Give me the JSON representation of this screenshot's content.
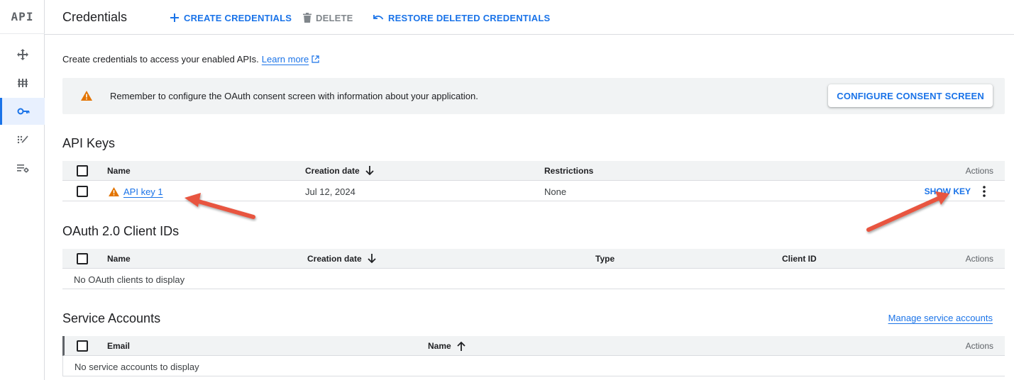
{
  "rail": {
    "logo": "API",
    "items": [
      {
        "icon": "dashboard-icon"
      },
      {
        "icon": "library-icon"
      },
      {
        "icon": "key-icon",
        "active": true
      },
      {
        "icon": "consent-icon"
      },
      {
        "icon": "settings-list-icon"
      }
    ]
  },
  "topbar": {
    "title": "Credentials",
    "create_label": "CREATE CREDENTIALS",
    "delete_label": "DELETE",
    "restore_label": "RESTORE DELETED CREDENTIALS"
  },
  "intro": {
    "text": "Create credentials to access your enabled APIs.",
    "link": "Learn more"
  },
  "banner": {
    "text": "Remember to configure the OAuth consent screen with information about your application.",
    "button": "CONFIGURE CONSENT SCREEN"
  },
  "api_keys": {
    "title": "API Keys",
    "headers": {
      "name": "Name",
      "created": "Creation date",
      "restrictions": "Restrictions",
      "actions": "Actions"
    },
    "rows": [
      {
        "name": "API key 1",
        "created": "Jul 12, 2024",
        "restrictions": "None",
        "action": "SHOW KEY"
      }
    ]
  },
  "oauth": {
    "title": "OAuth 2.0 Client IDs",
    "headers": {
      "name": "Name",
      "created": "Creation date",
      "type": "Type",
      "client_id": "Client ID",
      "actions": "Actions"
    },
    "empty": "No OAuth clients to display"
  },
  "service_accounts": {
    "title": "Service Accounts",
    "manage_link": "Manage service accounts",
    "headers": {
      "email": "Email",
      "name": "Name",
      "actions": "Actions"
    },
    "empty": "No service accounts to display"
  },
  "colors": {
    "accent": "#1a73e8",
    "warning": "#e37400",
    "annotation_arrow": "#e8553f"
  }
}
